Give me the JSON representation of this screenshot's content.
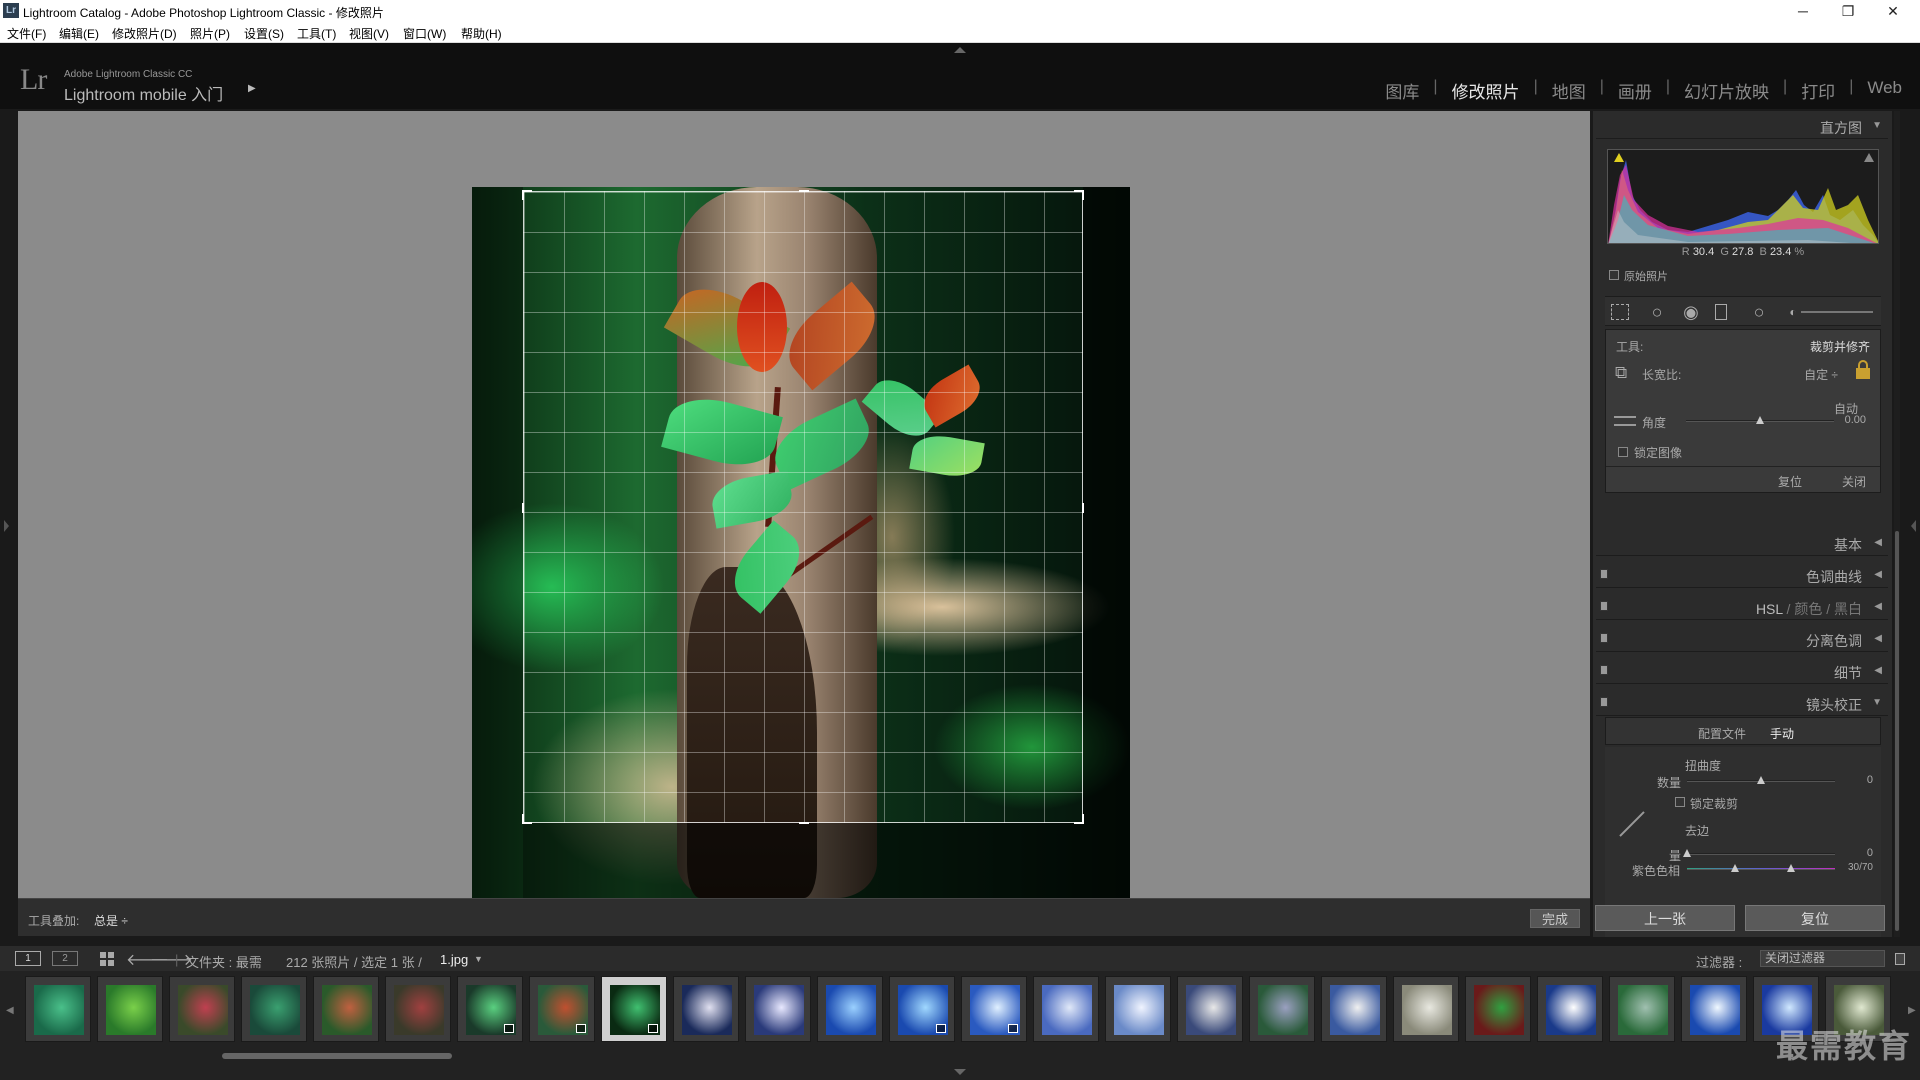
{
  "window": {
    "title": "Lightroom Catalog - Adobe Photoshop Lightroom Classic - 修改照片",
    "app_badge": "Lr",
    "minimize": "─",
    "restore": "❐",
    "close": "✕"
  },
  "menu": [
    "文件(F)",
    "编辑(E)",
    "修改照片(D)",
    "照片(P)",
    "设置(S)",
    "工具(T)",
    "视图(V)",
    "窗口(W)",
    "帮助(H)"
  ],
  "identity": {
    "logo": "Lr",
    "brand_small": "Adobe Lightroom Classic CC",
    "brand_large": "Lightroom mobile 入门",
    "arrow": "▶"
  },
  "modules": [
    {
      "label": "图库",
      "active": false
    },
    {
      "label": "修改照片",
      "active": true
    },
    {
      "label": "地图",
      "active": false
    },
    {
      "label": "画册",
      "active": false
    },
    {
      "label": "幻灯片放映",
      "active": false
    },
    {
      "label": "打印",
      "active": false
    },
    {
      "label": "Web",
      "active": false
    }
  ],
  "toolbar": {
    "overlay_label": "工具叠加:",
    "overlay_value": "总是 ÷",
    "done_label": "完成"
  },
  "right_panel": {
    "histogram_title": "直方图",
    "readout": {
      "r_label": "R",
      "r": "30.4",
      "g_label": "G",
      "g": "27.8",
      "b_label": "B",
      "b": "23.4",
      "unit": "%"
    },
    "original_photo": "原始照片",
    "tool_label": "工具:",
    "tool_name": "裁剪并修齐",
    "aspect_label": "长宽比:",
    "aspect_value": "自定 ÷",
    "auto_label": "自动",
    "angle_label": "角度",
    "angle_value": "0.00",
    "angle_fraction": 0.5,
    "lock_image": "锁定图像",
    "reset": "复位",
    "close": "关闭",
    "sections": [
      {
        "label": "基本"
      },
      {
        "label": "色调曲线"
      },
      {
        "label": "分离色调"
      },
      {
        "label": "细节"
      },
      {
        "label": "镜头校正"
      }
    ],
    "hsl": {
      "hsl": "HSL",
      "color": "颜色",
      "bw": "黑白",
      "sep": "/"
    },
    "lens_tabs": {
      "profile": "配置文件",
      "manual": "手动"
    },
    "distortion_title": "扭曲度",
    "amount_label": "数量",
    "amount_value": "0",
    "amount_fraction": 0.5,
    "constrain_crop": "锁定裁剪",
    "defringe_title": "去边",
    "quantity_label": "量",
    "quantity_value": "0",
    "quantity_fraction": 0.0,
    "purple_hue_label": "紫色色相",
    "purple_hue_value": "30/70"
  },
  "nav_buttons": {
    "prev": "上一张",
    "reset": "复位"
  },
  "filmstrip_bar": {
    "view1": "1",
    "view2": "2",
    "folder": "文件夹 : 最需",
    "count": "212 张照片 / 选定 1 张 /",
    "filename": "1.jpg",
    "filter_label": "过滤器 :",
    "filter_value": "关闭过滤器"
  },
  "watermark": "最需教育",
  "thumbnail_colors": [
    [
      "#1a6a4a",
      "#4ac08a"
    ],
    [
      "#2a7a2a",
      "#7ad04a"
    ],
    [
      "#3a4a2a",
      "#c04050"
    ],
    [
      "#1a4a3a",
      "#3aa070"
    ],
    [
      "#2a5a2a",
      "#c06040"
    ],
    [
      "#3a3a2a",
      "#a04040"
    ],
    [
      "#1a3a2a",
      "#5ad080"
    ],
    [
      "#2a5a3a",
      "#c05030"
    ],
    [
      "#0a2a12",
      "#40c070"
    ],
    [
      "#1a2a5a",
      "#e0e0f0"
    ],
    [
      "#2a3a7a",
      "#e8e8ff"
    ],
    [
      "#1a4ab0",
      "#9ad0ff"
    ],
    [
      "#1a4ab0",
      "#a0d8ff"
    ],
    [
      "#2a5ac0",
      "#e0f0ff"
    ],
    [
      "#4a6ac0",
      "#e0e8f8"
    ],
    [
      "#6a8ac8",
      "#f0f4ff"
    ],
    [
      "#3a4a7a",
      "#e8e8e8"
    ],
    [
      "#2a5a3a",
      "#9aa0c0"
    ],
    [
      "#3a5aa0",
      "#f0f0f0"
    ],
    [
      "#8a8a7a",
      "#e8e8e0"
    ],
    [
      "#6a1a1a",
      "#30a040"
    ],
    [
      "#1a3a8a",
      "#ffffff"
    ],
    [
      "#2a6a3a",
      "#a0c0b0"
    ],
    [
      "#1a4ab0",
      "#f0f8ff"
    ],
    [
      "#1a3aa0",
      "#d0e8ff"
    ],
    [
      "#4a5a3a",
      "#e0e8d0"
    ]
  ]
}
